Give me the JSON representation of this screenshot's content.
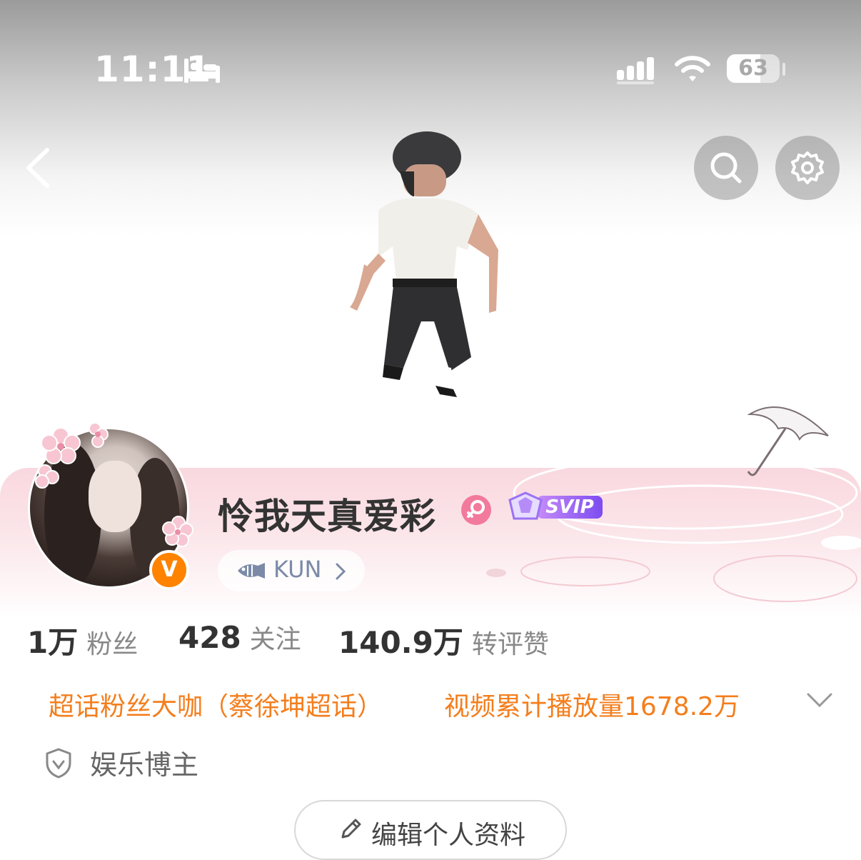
{
  "status_bar": {
    "time": "11:11",
    "battery_level": "63",
    "battery_fraction": 0.63,
    "icons": [
      "sleep-focus-icon",
      "signal-icon",
      "wifi-icon",
      "battery-icon"
    ]
  },
  "nav": {
    "back_icon": "chevron-left-icon",
    "search_icon": "search-icon",
    "settings_icon": "gear-icon"
  },
  "profile": {
    "username": "怜我天真爱彩",
    "verified_mark": "V",
    "gender_icon": "female-icon",
    "svip_label": "SVIP",
    "fan_group": {
      "label": "KUN",
      "chevron": "›",
      "icon": "fish-icon"
    }
  },
  "stats": [
    {
      "value": "1万",
      "label": "粉丝"
    },
    {
      "value": "428",
      "label": "关注"
    },
    {
      "value": "140.9万",
      "label": "转评赞"
    }
  ],
  "tags": {
    "left": "超话粉丝大咖（蔡徐坤超话）",
    "right": "视频累计播放量1678.2万",
    "expand_icon": "chevron-down-icon"
  },
  "category": {
    "label": "娱乐博主",
    "icon": "shield-check-icon"
  },
  "edit_profile": {
    "label": "编辑个人资料",
    "icon": "pencil-icon"
  },
  "colors": {
    "accent_orange": "#f47e1d",
    "verified_orange": "#ff8200",
    "gender_pink": "#f27a9c",
    "svip_purple": "#7d4cf0"
  }
}
